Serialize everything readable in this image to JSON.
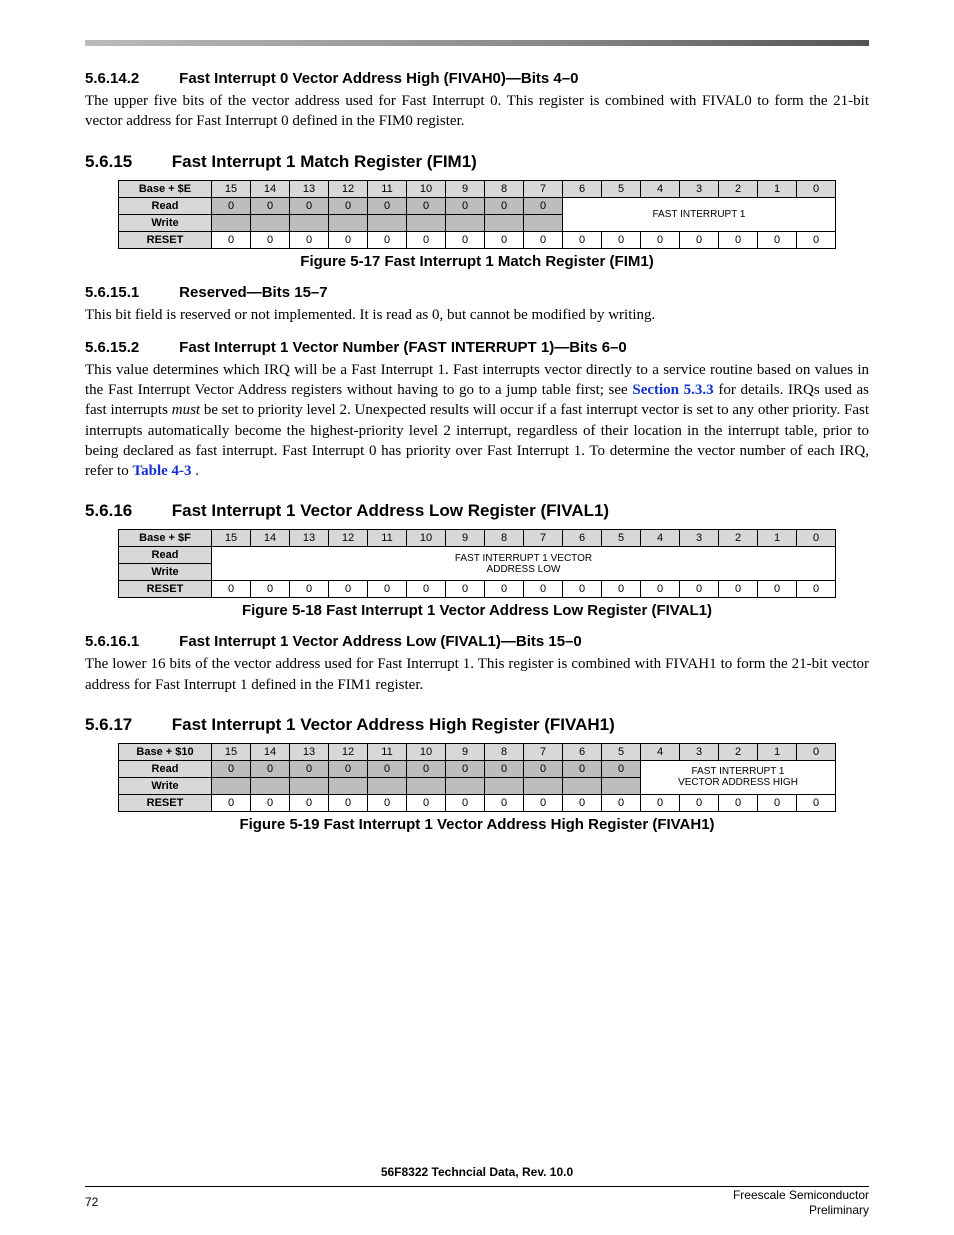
{
  "sec_5_6_14_2": {
    "num": "5.6.14.2",
    "title": "Fast Interrupt 0 Vector Address High (FIVAH0)—Bits 4–0",
    "body": "The upper five bits of the vector address used for Fast Interrupt 0. This register is combined with FIVAL0 to form the 21-bit vector address for Fast Interrupt 0 defined in the FIM0 register."
  },
  "sec_5_6_15": {
    "num": "5.6.15",
    "title": "Fast Interrupt 1 Match Register (FIM1)",
    "table": {
      "base_label": "Base + $E",
      "bits": [
        "15",
        "14",
        "13",
        "12",
        "11",
        "10",
        "9",
        "8",
        "7",
        "6",
        "5",
        "4",
        "3",
        "2",
        "1",
        "0"
      ],
      "read_label": "Read",
      "write_label": "Write",
      "reset_label": "RESET",
      "reserved_zeros": [
        "0",
        "0",
        "0",
        "0",
        "0",
        "0",
        "0",
        "0",
        "0"
      ],
      "field_label": "FAST INTERRUPT 1",
      "reset_vals": [
        "0",
        "0",
        "0",
        "0",
        "0",
        "0",
        "0",
        "0",
        "0",
        "0",
        "0",
        "0",
        "0",
        "0",
        "0",
        "0"
      ]
    },
    "caption": "Figure 5-17 Fast Interrupt 1 Match Register (FIM1)"
  },
  "sec_5_6_15_1": {
    "num": "5.6.15.1",
    "title": "Reserved—Bits 15–7",
    "body": "This bit field is reserved or not implemented. It is read as 0, but cannot be modified by writing."
  },
  "sec_5_6_15_2": {
    "num": "5.6.15.2",
    "title": "Fast Interrupt 1 Vector Number (FAST INTERRUPT 1)—Bits 6–0",
    "body_pre": "This value determines which IRQ will be a Fast Interrupt 1. Fast interrupts vector directly to a service routine based on values in the Fast Interrupt Vector Address registers without having to go to a jump table first; see ",
    "xref1": "Section 5.3.3",
    "body_mid": " for details. IRQs used as fast interrupts ",
    "must": "must",
    "body_mid2": " be set to priority level 2. Unexpected results will occur if a fast interrupt vector is set to any other priority. Fast interrupts automatically become the highest-priority level 2 interrupt, regardless of their location in the interrupt table, prior to being declared as fast interrupt. Fast Interrupt 0 has priority over Fast Interrupt 1. To determine the vector number of each IRQ, refer to ",
    "xref2": "Table 4-3",
    "body_end": "."
  },
  "sec_5_6_16": {
    "num": "5.6.16",
    "title": "Fast Interrupt 1 Vector Address Low Register (FIVAL1)",
    "table": {
      "base_label": "Base + $F",
      "bits": [
        "15",
        "14",
        "13",
        "12",
        "11",
        "10",
        "9",
        "8",
        "7",
        "6",
        "5",
        "4",
        "3",
        "2",
        "1",
        "0"
      ],
      "read_label": "Read",
      "write_label": "Write",
      "reset_label": "RESET",
      "field_label_l1": "FAST INTERRUPT 1 VECTOR",
      "field_label_l2": "ADDRESS LOW",
      "reset_vals": [
        "0",
        "0",
        "0",
        "0",
        "0",
        "0",
        "0",
        "0",
        "0",
        "0",
        "0",
        "0",
        "0",
        "0",
        "0",
        "0"
      ]
    },
    "caption": "Figure 5-18 Fast Interrupt 1 Vector Address Low Register (FIVAL1)"
  },
  "sec_5_6_16_1": {
    "num": "5.6.16.1",
    "title": "Fast Interrupt 1 Vector Address Low (FIVAL1)—Bits 15–0",
    "body": "The lower 16 bits of the vector address used for Fast Interrupt 1. This register is combined with FIVAH1 to form the 21-bit vector address for Fast Interrupt 1 defined in the FIM1 register."
  },
  "sec_5_6_17": {
    "num": "5.6.17",
    "title": "Fast Interrupt 1 Vector Address High Register (FIVAH1)",
    "table": {
      "base_label": "Base + $10",
      "bits": [
        "15",
        "14",
        "13",
        "12",
        "11",
        "10",
        "9",
        "8",
        "7",
        "6",
        "5",
        "4",
        "3",
        "2",
        "1",
        "0"
      ],
      "read_label": "Read",
      "write_label": "Write",
      "reset_label": "RESET",
      "reserved_zeros": [
        "0",
        "0",
        "0",
        "0",
        "0",
        "0",
        "0",
        "0",
        "0",
        "0",
        "0"
      ],
      "field_label_l1": "FAST INTERRUPT 1",
      "field_label_l2": "VECTOR ADDRESS HIGH",
      "reset_vals": [
        "0",
        "0",
        "0",
        "0",
        "0",
        "0",
        "0",
        "0",
        "0",
        "0",
        "0",
        "0",
        "0",
        "0",
        "0",
        "0"
      ]
    },
    "caption": "Figure 5-19 Fast Interrupt 1 Vector Address High Register (FIVAH1)"
  },
  "footer": {
    "doc": "56F8322 Techncial Data, Rev. 10.0",
    "page": "72",
    "company": "Freescale Semiconductor",
    "status": "Preliminary"
  }
}
